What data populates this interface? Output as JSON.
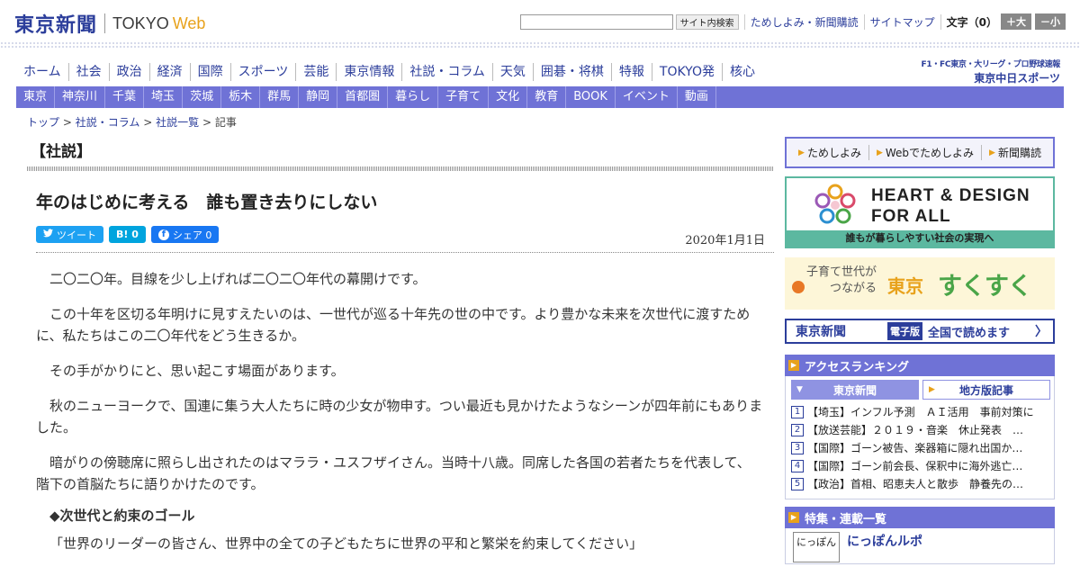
{
  "header": {
    "logo_jp": "東京新聞",
    "logo_en": "TOKYO",
    "logo_web": "Web",
    "search_placeholder": "",
    "search_button": "サイト内検索",
    "links": [
      "ためしよみ・新聞購読",
      "サイトマップ"
    ],
    "font_size_label": "文字（0）",
    "font_larger": "＋大",
    "font_smaller": "－小"
  },
  "main_nav": [
    "ホーム",
    "社会",
    "政治",
    "経済",
    "国際",
    "スポーツ",
    "芸能",
    "東京情報",
    "社説・コラム",
    "天気",
    "囲碁・将棋",
    "特報",
    "TOKYO発",
    "核心"
  ],
  "chunichi": {
    "small": "F1・FC東京・大リーグ・プロ野球速報",
    "big": "東京中日スポーツ"
  },
  "region_nav": [
    "東京",
    "神奈川",
    "千葉",
    "埼玉",
    "茨城",
    "栃木",
    "群馬",
    "静岡",
    "首都圏",
    "暮らし",
    "子育て",
    "文化",
    "教育",
    "BOOK",
    "イベント",
    "動画"
  ],
  "breadcrumb": {
    "items": [
      "トップ",
      "社説・コラム",
      "社説一覧"
    ],
    "current": "記事",
    "sep": ">"
  },
  "article": {
    "section": "【社説】",
    "title": "年のはじめに考える　誰も置き去りにしない",
    "date": "2020年1月1日",
    "share": {
      "tweet": "ツイート",
      "hatena": "B! 0",
      "facebook": "シェア 0"
    },
    "paragraphs": [
      "二〇二〇年。目線を少し上げれば二〇二〇年代の幕開けです。",
      "この十年を区切る年明けに見すえたいのは、一世代が巡る十年先の世の中です。より豊かな未来を次世代に渡すために、私たちはこの二〇年代をどう生きるか。",
      "その手がかりにと、思い起こす場面があります。",
      "秋のニューヨークで、国連に集う大人たちに時の少女が物申す。つい最近も見かけたようなシーンが四年前にもありました。",
      "暗がりの傍聴席に照らし出されたのはマララ・ユスフザイさん。当時十八歳。同席した各国の若者たちを代表して、階下の首脳たちに語りかけたのです。"
    ],
    "subhead": "◆次世代と約束のゴール",
    "quote": "「世界のリーダーの皆さん、世界中の全ての子どもたちに世界の平和と繁栄を約束してください」"
  },
  "sidebar": {
    "trial_links": [
      "ためしよみ",
      "Webでためしよみ",
      "新聞購読"
    ],
    "heart_design": {
      "title_line1": "HEART & DESIGN",
      "title_line2": "FOR ALL",
      "strip": "誰もが暮らしやすい社会の実現へ"
    },
    "sukusuku": {
      "line1": "子育て世代が",
      "line2": "つながる",
      "city": "東京",
      "main": "すくすく"
    },
    "edenshi": {
      "name": "東京新聞",
      "tag": "電子版",
      "text": "全国で読めます",
      "arrow": "〉"
    },
    "ranking": {
      "title": "アクセスランキング",
      "tab_active": "東京新聞",
      "tab_inactive": "地方版記事",
      "items": [
        {
          "num": "1",
          "text": "【埼玉】インフル予測　ＡＩ活用　事前対策に"
        },
        {
          "num": "2",
          "text": "【放送芸能】２０１９・音楽　休止発表　…"
        },
        {
          "num": "3",
          "text": "【国際】ゴーン被告、楽器箱に隠れ出国か…"
        },
        {
          "num": "4",
          "text": "【国際】ゴーン前会長、保釈中に海外逃亡…"
        },
        {
          "num": "5",
          "text": "【政治】首相、昭恵夫人と散歩　静養先の…"
        }
      ]
    },
    "features": {
      "title": "特集・連載一覧",
      "first_thumb": "にっぽん",
      "first_title": "にっぽんルポ"
    }
  }
}
